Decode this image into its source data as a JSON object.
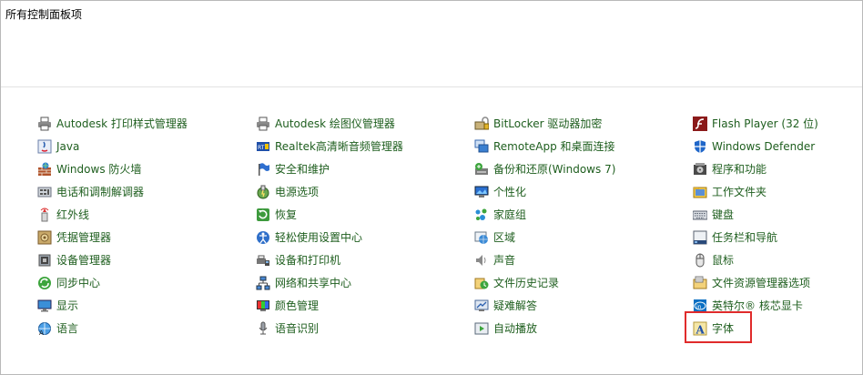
{
  "header": {
    "title": "所有控制面板项"
  },
  "columns": [
    [
      {
        "label": "Autodesk 打印样式管理器",
        "icon": "printer-icon"
      },
      {
        "label": "Java",
        "icon": "java-icon"
      },
      {
        "label": "Windows 防火墙",
        "icon": "firewall-icon"
      },
      {
        "label": "电话和调制解调器",
        "icon": "phone-modem-icon"
      },
      {
        "label": "红外线",
        "icon": "infrared-icon"
      },
      {
        "label": "凭据管理器",
        "icon": "credential-icon"
      },
      {
        "label": "设备管理器",
        "icon": "device-manager-icon"
      },
      {
        "label": "同步中心",
        "icon": "sync-icon"
      },
      {
        "label": "显示",
        "icon": "display-icon"
      },
      {
        "label": "语言",
        "icon": "language-icon"
      }
    ],
    [
      {
        "label": "Autodesk 绘图仪管理器",
        "icon": "plotter-icon"
      },
      {
        "label": "Realtek高清晰音频管理器",
        "icon": "realtek-audio-icon"
      },
      {
        "label": "安全和维护",
        "icon": "security-flag-icon"
      },
      {
        "label": "电源选项",
        "icon": "power-icon"
      },
      {
        "label": "恢复",
        "icon": "recovery-icon"
      },
      {
        "label": "轻松使用设置中心",
        "icon": "ease-of-access-icon"
      },
      {
        "label": "设备和打印机",
        "icon": "devices-printers-icon"
      },
      {
        "label": "网络和共享中心",
        "icon": "network-icon"
      },
      {
        "label": "颜色管理",
        "icon": "color-management-icon"
      },
      {
        "label": "语音识别",
        "icon": "microphone-icon"
      }
    ],
    [
      {
        "label": "BitLocker 驱动器加密",
        "icon": "bitlocker-icon"
      },
      {
        "label": "RemoteApp 和桌面连接",
        "icon": "remoteapp-icon"
      },
      {
        "label": "备份和还原(Windows 7)",
        "icon": "backup-icon"
      },
      {
        "label": "个性化",
        "icon": "personalization-icon"
      },
      {
        "label": "家庭组",
        "icon": "homegroup-icon"
      },
      {
        "label": "区域",
        "icon": "region-icon"
      },
      {
        "label": "声音",
        "icon": "sound-icon"
      },
      {
        "label": "文件历史记录",
        "icon": "file-history-icon"
      },
      {
        "label": "疑难解答",
        "icon": "troubleshoot-icon"
      },
      {
        "label": "自动播放",
        "icon": "autoplay-icon"
      }
    ],
    [
      {
        "label": "Flash Player (32 位)",
        "icon": "flash-icon"
      },
      {
        "label": "Windows Defender",
        "icon": "defender-icon"
      },
      {
        "label": "程序和功能",
        "icon": "programs-icon"
      },
      {
        "label": "工作文件夹",
        "icon": "work-folders-icon"
      },
      {
        "label": "键盘",
        "icon": "keyboard-icon"
      },
      {
        "label": "任务栏和导航",
        "icon": "taskbar-icon"
      },
      {
        "label": "鼠标",
        "icon": "mouse-icon"
      },
      {
        "label": "文件资源管理器选项",
        "icon": "folder-options-icon"
      },
      {
        "label": "英特尔® 核芯显卡",
        "icon": "intel-graphics-icon"
      },
      {
        "label": "字体",
        "icon": "fonts-icon"
      }
    ]
  ],
  "colors": {
    "link": "#1e5e1e",
    "highlight": "#e02b2b"
  }
}
